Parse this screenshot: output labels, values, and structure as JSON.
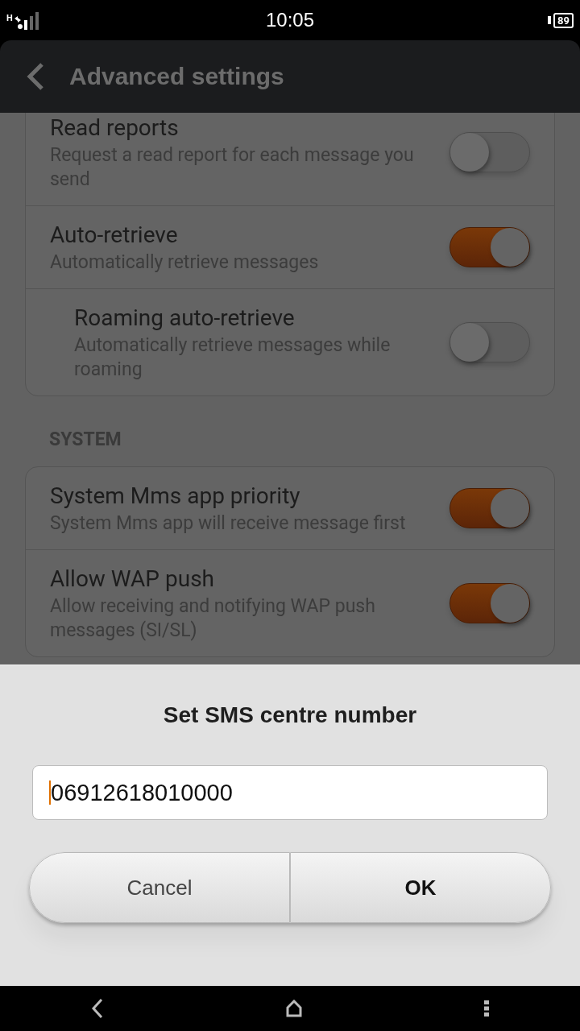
{
  "status_bar": {
    "network": "H",
    "time": "10:05",
    "battery": "89"
  },
  "header": {
    "title": "Advanced settings"
  },
  "sections": [
    {
      "items": [
        {
          "title": "Read reports",
          "summary": "Request a read report for each message you send",
          "on": false
        },
        {
          "title": "Auto-retrieve",
          "summary": "Automatically retrieve messages",
          "on": true,
          "children": [
            {
              "title": "Roaming auto-retrieve",
              "summary": "Automatically retrieve messages while roaming",
              "on": false
            }
          ]
        }
      ]
    },
    {
      "header": "SYSTEM",
      "items": [
        {
          "title": "System Mms app priority",
          "summary": "System Mms app will receive message first",
          "on": true
        },
        {
          "title": "Allow WAP push",
          "summary": "Allow receiving and notifying WAP push messages (SI/SL)",
          "on": true
        }
      ]
    }
  ],
  "dialog": {
    "title": "Set SMS centre number",
    "value": "06912618010000",
    "buttons": [
      {
        "label": "Cancel",
        "kind": "cancel"
      },
      {
        "label": "OK",
        "kind": "confirm"
      }
    ]
  }
}
